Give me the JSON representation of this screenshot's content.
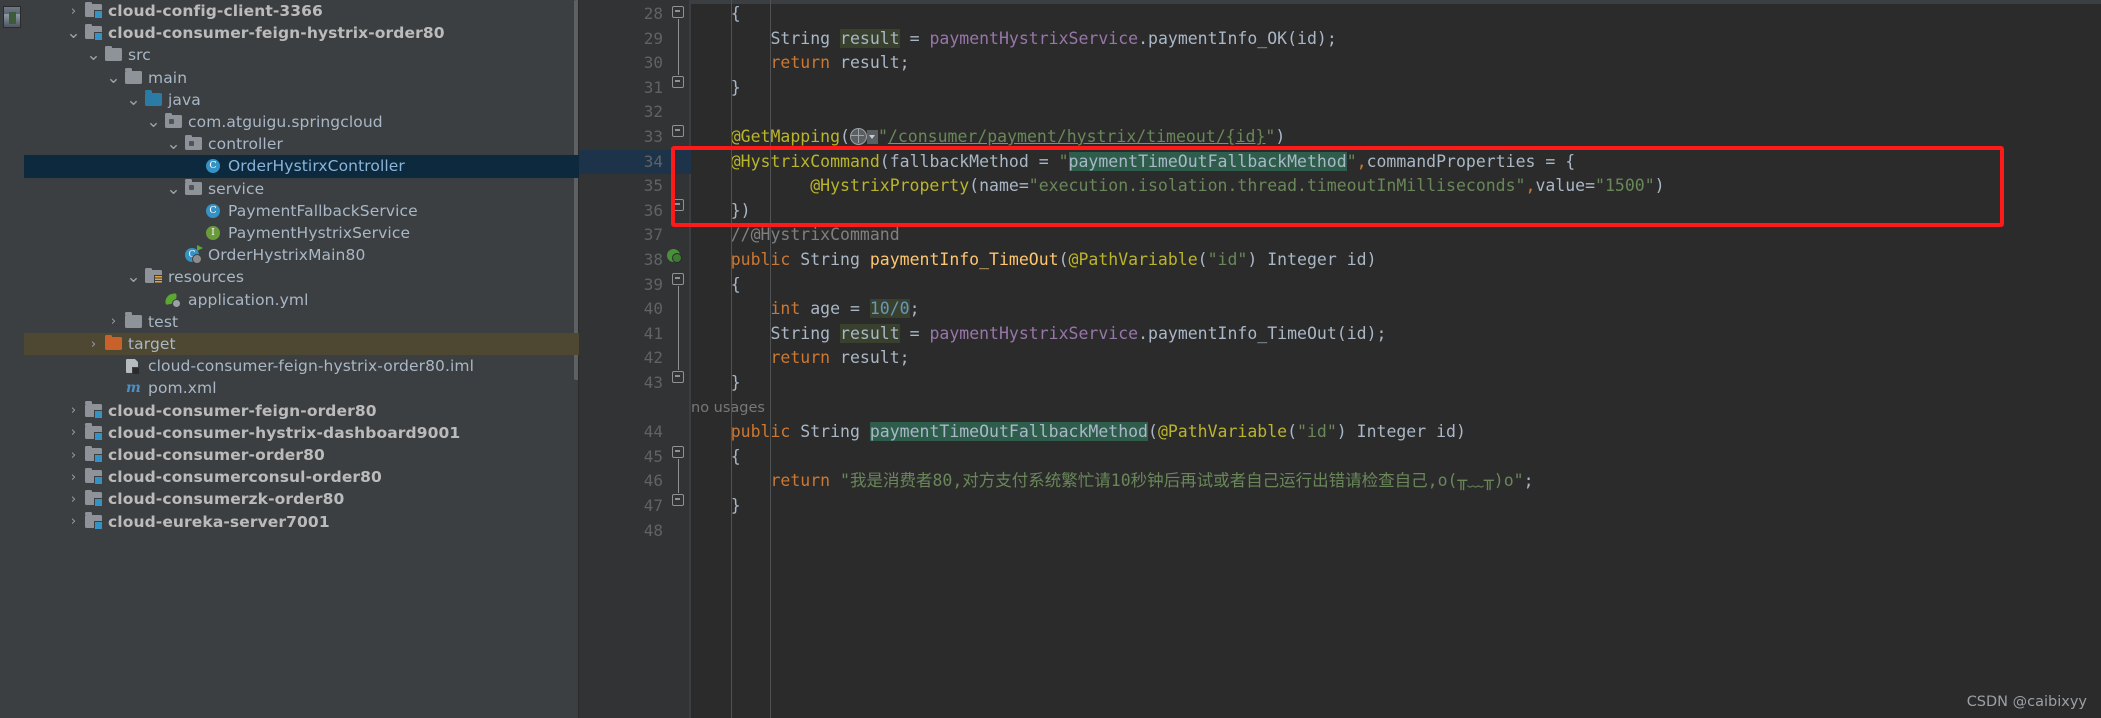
{
  "app": {
    "watermark": "CSDN @caibixyy"
  },
  "sidebar": {
    "avatar_alt": "user-avatar",
    "items": [
      {
        "indent": 1,
        "arrow": "collapsed",
        "icon": "module-folder-icon",
        "label": "cloud-config-client-3366",
        "bold": true,
        "state": "normal"
      },
      {
        "indent": 1,
        "arrow": "expanded",
        "icon": "module-folder-icon",
        "label": "cloud-consumer-feign-hystrix-order80",
        "bold": true,
        "state": "normal"
      },
      {
        "indent": 2,
        "arrow": "expanded",
        "icon": "folder-icon",
        "label": "src",
        "bold": false,
        "state": "normal"
      },
      {
        "indent": 3,
        "arrow": "expanded",
        "icon": "folder-icon",
        "label": "main",
        "bold": false,
        "state": "normal"
      },
      {
        "indent": 4,
        "arrow": "expanded",
        "icon": "source-folder-icon",
        "label": "java",
        "bold": false,
        "state": "normal"
      },
      {
        "indent": 5,
        "arrow": "expanded",
        "icon": "package-icon",
        "label": "com.atguigu.springcloud",
        "bold": false,
        "state": "normal"
      },
      {
        "indent": 6,
        "arrow": "expanded",
        "icon": "package-icon",
        "label": "controller",
        "bold": false,
        "state": "normal"
      },
      {
        "indent": 7,
        "arrow": "none",
        "icon": "java-class-icon",
        "label": "OrderHystirxController",
        "bold": false,
        "state": "selected"
      },
      {
        "indent": 6,
        "arrow": "expanded",
        "icon": "package-icon",
        "label": "service",
        "bold": false,
        "state": "normal"
      },
      {
        "indent": 7,
        "arrow": "none",
        "icon": "java-class-icon",
        "label": "PaymentFallbackService",
        "bold": false,
        "state": "normal"
      },
      {
        "indent": 7,
        "arrow": "none",
        "icon": "java-interface-icon",
        "label": "PaymentHystrixService",
        "bold": false,
        "state": "normal"
      },
      {
        "indent": 6,
        "arrow": "none",
        "icon": "spring-boot-class-icon",
        "label": "OrderHystrixMain80",
        "bold": false,
        "state": "normal"
      },
      {
        "indent": 4,
        "arrow": "expanded",
        "icon": "resources-folder-icon",
        "label": "resources",
        "bold": false,
        "state": "normal"
      },
      {
        "indent": 5,
        "arrow": "none",
        "icon": "spring-yaml-icon",
        "label": "application.yml",
        "bold": false,
        "state": "normal"
      },
      {
        "indent": 3,
        "arrow": "collapsed",
        "icon": "folder-icon",
        "label": "test",
        "bold": false,
        "state": "normal"
      },
      {
        "indent": 2,
        "arrow": "collapsed",
        "icon": "target-folder-icon",
        "label": "target",
        "bold": false,
        "state": "hover"
      },
      {
        "indent": 3,
        "arrow": "none",
        "icon": "iml-file-icon",
        "label": "cloud-consumer-feign-hystrix-order80.iml",
        "bold": false,
        "state": "normal"
      },
      {
        "indent": 3,
        "arrow": "none",
        "icon": "maven-pom-icon",
        "label": "pom.xml",
        "bold": false,
        "state": "normal"
      },
      {
        "indent": 1,
        "arrow": "collapsed",
        "icon": "module-folder-icon",
        "label": "cloud-consumer-feign-order80",
        "bold": true,
        "state": "normal"
      },
      {
        "indent": 1,
        "arrow": "collapsed",
        "icon": "module-folder-icon",
        "label": "cloud-consumer-hystrix-dashboard9001",
        "bold": true,
        "state": "normal"
      },
      {
        "indent": 1,
        "arrow": "collapsed",
        "icon": "module-folder-icon",
        "label": "cloud-consumer-order80",
        "bold": true,
        "state": "normal"
      },
      {
        "indent": 1,
        "arrow": "collapsed",
        "icon": "module-folder-icon",
        "label": "cloud-consumerconsul-order80",
        "bold": true,
        "state": "normal"
      },
      {
        "indent": 1,
        "arrow": "collapsed",
        "icon": "module-folder-icon",
        "label": "cloud-consumerzk-order80",
        "bold": true,
        "state": "normal"
      },
      {
        "indent": 1,
        "arrow": "collapsed",
        "icon": "module-folder-icon",
        "label": "cloud-eureka-server7001",
        "bold": true,
        "state": "normal"
      }
    ]
  },
  "editor": {
    "first_line_number": 28,
    "lines": [
      {
        "n": 28,
        "tokens": [
          {
            "t": "    ",
            "c": "plain"
          },
          {
            "t": "{",
            "c": "punct"
          }
        ]
      },
      {
        "n": 29,
        "tokens": [
          {
            "t": "        ",
            "c": "plain"
          },
          {
            "t": "String",
            "c": "typ"
          },
          {
            "t": " ",
            "c": "plain"
          },
          {
            "t": "result",
            "c": "ident-hl"
          },
          {
            "t": " = ",
            "c": "plain"
          },
          {
            "t": "paymentHystrixService",
            "c": "fld"
          },
          {
            "t": ".",
            "c": "plain"
          },
          {
            "t": "paymentInfo_OK",
            "c": "mth"
          },
          {
            "t": "(",
            "c": "punct"
          },
          {
            "t": "id",
            "c": "plain"
          },
          {
            "t": ");",
            "c": "punct"
          }
        ]
      },
      {
        "n": 30,
        "tokens": [
          {
            "t": "        ",
            "c": "plain"
          },
          {
            "t": "return",
            "c": "kw"
          },
          {
            "t": " result;",
            "c": "plain"
          }
        ]
      },
      {
        "n": 31,
        "tokens": [
          {
            "t": "    ",
            "c": "plain"
          },
          {
            "t": "}",
            "c": "punct"
          }
        ]
      },
      {
        "n": 32,
        "tokens": []
      },
      {
        "n": 33,
        "tokens": [
          {
            "t": "    ",
            "c": "plain"
          },
          {
            "t": "@GetMapping",
            "c": "ann"
          },
          {
            "t": "(",
            "c": "punct"
          },
          {
            "t": "GLOBE",
            "c": "icon"
          },
          {
            "t": "\"",
            "c": "str"
          },
          {
            "t": "/consumer/payment/hystrix/timeout/{id}",
            "c": "link"
          },
          {
            "t": "\"",
            "c": "str"
          },
          {
            "t": ")",
            "c": "punct"
          }
        ]
      },
      {
        "n": 34,
        "tokens": [
          {
            "t": "    ",
            "c": "plain"
          },
          {
            "t": "@HystrixCommand",
            "c": "ann"
          },
          {
            "t": "(",
            "c": "punct"
          },
          {
            "t": "fallbackMethod",
            "c": "plain"
          },
          {
            "t": " = ",
            "c": "plain"
          },
          {
            "t": "\"",
            "c": "str"
          },
          {
            "t": "paymentTimeOutFallbackMethod",
            "c": "sel-hl"
          },
          {
            "t": "\"",
            "c": "str"
          },
          {
            "t": ",",
            "c": "kw"
          },
          {
            "t": "commandProperties",
            "c": "plain"
          },
          {
            "t": " = {",
            "c": "plain"
          }
        ]
      },
      {
        "n": 35,
        "tokens": [
          {
            "t": "            ",
            "c": "plain"
          },
          {
            "t": "@HystrixProperty",
            "c": "ann"
          },
          {
            "t": "(",
            "c": "punct"
          },
          {
            "t": "name",
            "c": "plain"
          },
          {
            "t": "=",
            "c": "plain"
          },
          {
            "t": "\"execution.isolation.thread.timeoutInMilliseconds\"",
            "c": "str"
          },
          {
            "t": ",",
            "c": "kw"
          },
          {
            "t": "value",
            "c": "plain"
          },
          {
            "t": "=",
            "c": "plain"
          },
          {
            "t": "\"1500\"",
            "c": "str"
          },
          {
            "t": ")",
            "c": "punct"
          }
        ]
      },
      {
        "n": 36,
        "tokens": [
          {
            "t": "    ",
            "c": "plain"
          },
          {
            "t": "})",
            "c": "punct"
          }
        ]
      },
      {
        "n": 37,
        "tokens": [
          {
            "t": "    ",
            "c": "plain"
          },
          {
            "t": "//@HystrixCommand",
            "c": "cmt"
          }
        ]
      },
      {
        "n": 38,
        "tokens": [
          {
            "t": "    ",
            "c": "plain"
          },
          {
            "t": "public",
            "c": "kw"
          },
          {
            "t": " ",
            "c": "plain"
          },
          {
            "t": "String",
            "c": "typ"
          },
          {
            "t": " ",
            "c": "plain"
          },
          {
            "t": "paymentInfo_TimeOut",
            "c": "fn"
          },
          {
            "t": "(",
            "c": "punct"
          },
          {
            "t": "@PathVariable",
            "c": "ann"
          },
          {
            "t": "(",
            "c": "punct"
          },
          {
            "t": "\"id\"",
            "c": "str"
          },
          {
            "t": ") ",
            "c": "punct"
          },
          {
            "t": "Integer",
            "c": "typ"
          },
          {
            "t": " id)",
            "c": "plain"
          }
        ]
      },
      {
        "n": 39,
        "tokens": [
          {
            "t": "    ",
            "c": "plain"
          },
          {
            "t": "{",
            "c": "punct"
          }
        ]
      },
      {
        "n": 40,
        "tokens": [
          {
            "t": "        ",
            "c": "plain"
          },
          {
            "t": "int",
            "c": "kw"
          },
          {
            "t": " ",
            "c": "plain"
          },
          {
            "t": "age",
            "c": "plain"
          },
          {
            "t": " = ",
            "c": "plain"
          },
          {
            "t": "10/0",
            "c": "num-hl"
          },
          {
            "t": ";",
            "c": "punct"
          }
        ]
      },
      {
        "n": 41,
        "tokens": [
          {
            "t": "        ",
            "c": "plain"
          },
          {
            "t": "String",
            "c": "typ"
          },
          {
            "t": " ",
            "c": "plain"
          },
          {
            "t": "result",
            "c": "ident-hl"
          },
          {
            "t": " = ",
            "c": "plain"
          },
          {
            "t": "paymentHystrixService",
            "c": "fld"
          },
          {
            "t": ".",
            "c": "plain"
          },
          {
            "t": "paymentInfo_TimeOut",
            "c": "mth"
          },
          {
            "t": "(",
            "c": "punct"
          },
          {
            "t": "id",
            "c": "plain"
          },
          {
            "t": ");",
            "c": "punct"
          }
        ]
      },
      {
        "n": 42,
        "tokens": [
          {
            "t": "        ",
            "c": "plain"
          },
          {
            "t": "return",
            "c": "kw"
          },
          {
            "t": " result;",
            "c": "plain"
          }
        ]
      },
      {
        "n": 43,
        "tokens": [
          {
            "t": "    ",
            "c": "plain"
          },
          {
            "t": "}",
            "c": "punct"
          }
        ]
      },
      {
        "n": "",
        "tokens": [],
        "usages": "no usages"
      },
      {
        "n": 44,
        "tokens": [
          {
            "t": "    ",
            "c": "plain"
          },
          {
            "t": "public",
            "c": "kw"
          },
          {
            "t": " ",
            "c": "plain"
          },
          {
            "t": "String",
            "c": "typ"
          },
          {
            "t": " ",
            "c": "plain"
          },
          {
            "t": "paymentTimeOutFallbackMethod",
            "c": "sel-hl"
          },
          {
            "t": "(",
            "c": "punct"
          },
          {
            "t": "@PathVariable",
            "c": "ann"
          },
          {
            "t": "(",
            "c": "punct"
          },
          {
            "t": "\"id\"",
            "c": "str"
          },
          {
            "t": ") ",
            "c": "punct"
          },
          {
            "t": "Integer",
            "c": "typ"
          },
          {
            "t": " id)",
            "c": "plain"
          }
        ]
      },
      {
        "n": 45,
        "tokens": [
          {
            "t": "    ",
            "c": "plain"
          },
          {
            "t": "{",
            "c": "punct"
          }
        ]
      },
      {
        "n": 46,
        "tokens": [
          {
            "t": "        ",
            "c": "plain"
          },
          {
            "t": "return",
            "c": "kw"
          },
          {
            "t": " ",
            "c": "plain"
          },
          {
            "t": "\"我是消费者80,对方支付系统繁忙请10秒钟后再试或者自己运行出错请检查自己,o(╥﹏╥)o\"",
            "c": "str"
          },
          {
            "t": ";",
            "c": "punct"
          }
        ]
      },
      {
        "n": 47,
        "tokens": [
          {
            "t": "    ",
            "c": "plain"
          },
          {
            "t": "}",
            "c": "punct"
          }
        ]
      },
      {
        "n": 48,
        "tokens": []
      }
    ],
    "annotation_box": {
      "color": "#ff1a1a",
      "label": "hystrix-command-annotation-highlight"
    }
  }
}
